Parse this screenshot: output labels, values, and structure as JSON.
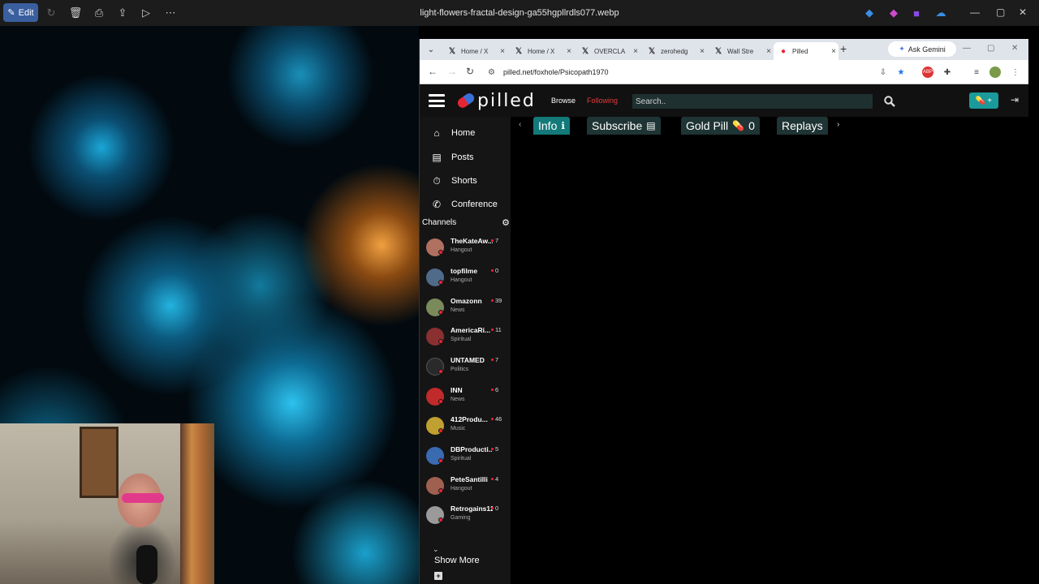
{
  "viewer": {
    "edit_label": "Edit",
    "file_title": "light-flowers-fractal-design-ga55hgpllrdls077.webp"
  },
  "browser": {
    "tabs": [
      {
        "title": "Home / X",
        "favicon": "x-logo-icon"
      },
      {
        "title": "Home / X",
        "favicon": "x-logo-icon"
      },
      {
        "title": "OVERCLA",
        "favicon": "x-logo-icon"
      },
      {
        "title": "zerohedg",
        "favicon": "x-logo-icon"
      },
      {
        "title": "Wall Stre",
        "favicon": "x-logo-icon"
      },
      {
        "title": "Pilled",
        "favicon": "pilled-icon"
      }
    ],
    "active_tab_index": 5,
    "gemini_label": "Ask Gemini",
    "url": "pilled.net/foxhole/Psicopath1970"
  },
  "site": {
    "logo_text": "pilled",
    "nav_browse": "Browse",
    "nav_following": "Following",
    "search_placeholder": "Search..",
    "accent_color": "#137979",
    "following_color": "#e83a3a"
  },
  "sidebar": {
    "items": [
      {
        "label": "Home",
        "icon": "home-icon"
      },
      {
        "label": "Posts",
        "icon": "posts-icon"
      },
      {
        "label": "Shorts",
        "icon": "stopwatch-icon"
      },
      {
        "label": "Conference",
        "icon": "phone-icon"
      }
    ],
    "channels_heading": "Channels",
    "channels": [
      {
        "name": "TheKateAw...",
        "category": "Hangout",
        "count": "7",
        "avatar": "#b07060"
      },
      {
        "name": "topfilme",
        "category": "Hangout",
        "count": "0",
        "avatar": "#506a8a"
      },
      {
        "name": "Omazonn",
        "category": "News",
        "count": "39",
        "avatar": "#7a8a5a"
      },
      {
        "name": "AmericaRi...",
        "category": "Spiritual",
        "count": "11",
        "avatar": "#8a3030"
      },
      {
        "name": "UNTAMED",
        "category": "Politics",
        "count": "7",
        "avatar": "#2a2a2a"
      },
      {
        "name": "INN",
        "category": "News",
        "count": "6",
        "avatar": "#c02a2a"
      },
      {
        "name": "412Produ...",
        "category": "Music",
        "count": "46",
        "avatar": "#c0a030"
      },
      {
        "name": "DBProducti...",
        "category": "Spiritual",
        "count": "5",
        "avatar": "#3a6ab0"
      },
      {
        "name": "PeteSantilli",
        "category": "Hangout",
        "count": "4",
        "avatar": "#a06050"
      },
      {
        "name": "Retrogains12",
        "category": "Gaming",
        "count": "0",
        "avatar": "#9a9a9a"
      }
    ],
    "show_more": "Show More"
  },
  "channel_tabs": [
    {
      "label": "Info",
      "icon": "info-icon"
    },
    {
      "label": "Subscribe",
      "icon": "card-icon"
    },
    {
      "label": "Gold Pill",
      "icon": "gold-pill-icon",
      "count": "0"
    },
    {
      "label": "Replays",
      "icon": ""
    }
  ]
}
